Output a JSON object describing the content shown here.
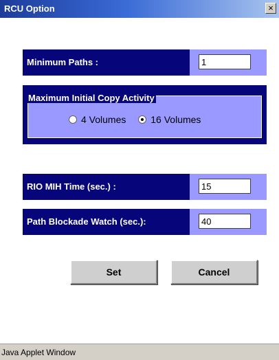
{
  "window": {
    "title": "RCU Option",
    "close_glyph": "×"
  },
  "form": {
    "minimum_paths": {
      "label": "Minimum Paths :",
      "value": "1"
    },
    "max_copy": {
      "title": "Maximum Initial Copy Activity",
      "options": [
        {
          "label": "4 Volumes",
          "checked": false
        },
        {
          "label": "16 Volumes",
          "checked": true
        }
      ]
    },
    "rio_mih": {
      "label": "RIO MIH Time (sec.) :",
      "value": "15"
    },
    "path_blockade": {
      "label": "Path Blockade Watch (sec.):",
      "value": "40"
    }
  },
  "buttons": {
    "set": "Set",
    "cancel": "Cancel"
  },
  "status_bar": {
    "text": "Java Applet Window"
  },
  "colors": {
    "label_bg": "#06067a",
    "panel_bg": "#9999ff",
    "button_bg": "#cfcfcf"
  }
}
